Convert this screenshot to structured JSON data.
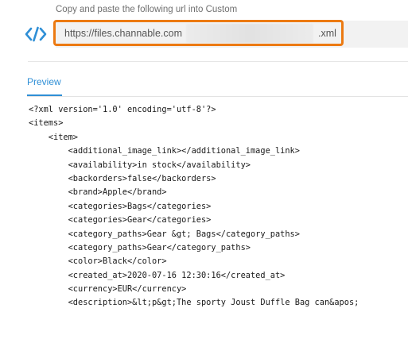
{
  "url_section": {
    "caption": "Copy and paste the following url into Custom",
    "url_prefix": "https://files.channable.com",
    "url_suffix": ".xml",
    "code_icon": "code-brackets-icon",
    "colors": {
      "highlight": "#ec7a12",
      "icon": "#2f8fd6"
    }
  },
  "tabs": {
    "preview_label": "Preview",
    "active_color": "#2f8fd6"
  },
  "preview": {
    "lines": [
      "<?xml version='1.0' encoding='utf-8'?>",
      "<items>",
      "    <item>",
      "        <additional_image_link></additional_image_link>",
      "        <availability>in stock</availability>",
      "        <backorders>false</backorders>",
      "        <brand>Apple</brand>",
      "        <categories>Bags</categories>",
      "        <categories>Gear</categories>",
      "        <category_paths>Gear &gt; Bags</category_paths>",
      "        <category_paths>Gear</category_paths>",
      "        <color>Black</color>",
      "        <created_at>2020-07-16 12:30:16</created_at>",
      "        <currency>EUR</currency>",
      "        <description>&lt;p&gt;The sporty Joust Duffle Bag can&apos;"
    ]
  }
}
